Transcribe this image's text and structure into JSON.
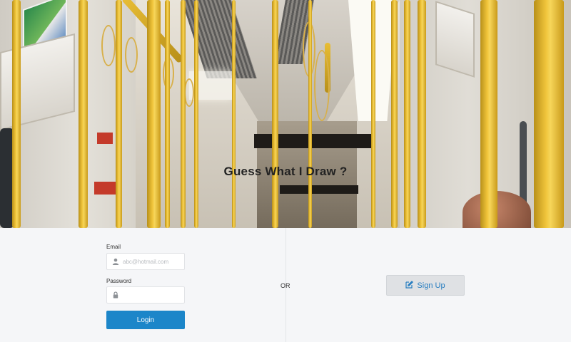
{
  "hero": {
    "title": "Guess What I Draw ?"
  },
  "login_form": {
    "email_label": "Email",
    "email_placeholder": "abc@hotmail.com",
    "email_icon": "user-icon",
    "password_label": "Password",
    "password_placeholder": "",
    "password_icon": "lock-icon",
    "login_label": "Login"
  },
  "separator": {
    "or_label": "OR"
  },
  "signup": {
    "label": "Sign Up",
    "icon": "edit-icon"
  },
  "colors": {
    "primary": "#1c86c9",
    "signup_bg": "#dfe1e4",
    "signup_text": "#2a7fc1",
    "pole_yellow": "#f0c43a"
  }
}
